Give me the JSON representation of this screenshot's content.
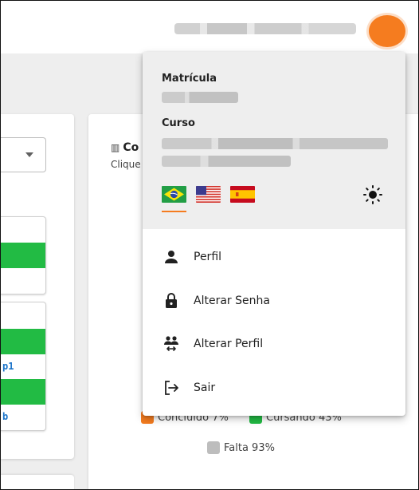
{
  "chart": {
    "title_partial": "Co",
    "subtitle_partial": "Clique",
    "legend": [
      {
        "label": "Concluído 7%",
        "color": "#f57c1f"
      },
      {
        "label": "Cursando 43%",
        "color": "#22bb44"
      },
      {
        "label": "Falta 93%",
        "color": "#bdbdbd"
      }
    ]
  },
  "left_panel": {
    "link_1": "p1",
    "link_2": "b"
  },
  "menu": {
    "matricula_label": "Matrícula",
    "curso_label": "Curso",
    "languages": [
      "pt-BR",
      "en-US",
      "es-ES"
    ],
    "selected_language": "pt-BR",
    "items": [
      {
        "label": "Perfil",
        "icon": "person-icon"
      },
      {
        "label": "Alterar Senha",
        "icon": "lock-icon"
      },
      {
        "label": "Alterar Perfil",
        "icon": "swap-people-icon"
      },
      {
        "label": "Sair",
        "icon": "logout-icon"
      }
    ]
  },
  "colors": {
    "accent": "#f57c1f",
    "green": "#22bb44",
    "link_blue": "#1a73c8"
  }
}
